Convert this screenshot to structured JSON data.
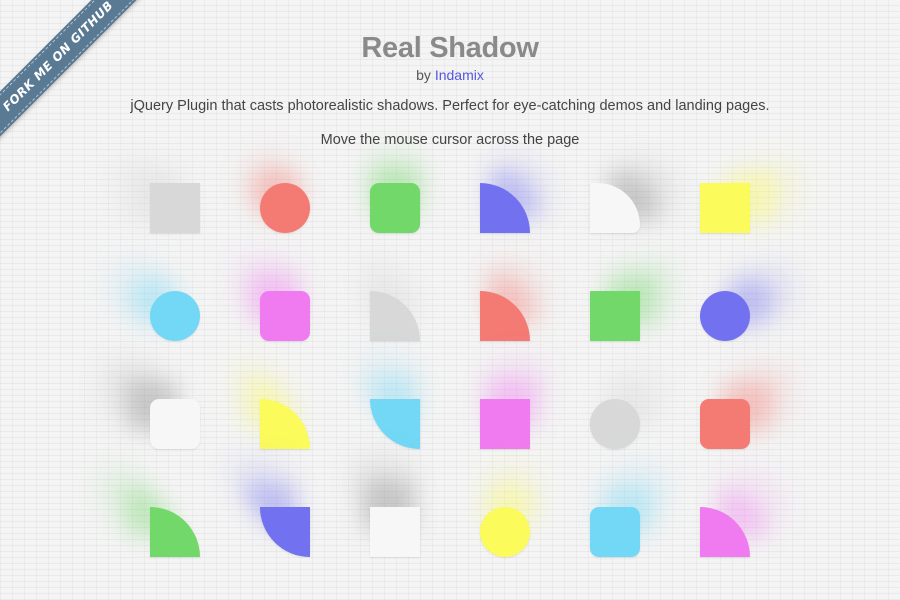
{
  "ribbon": {
    "label": "FORK ME ON GITHUB"
  },
  "header": {
    "title": "Real Shadow",
    "by_prefix": "by",
    "author": "Indamix",
    "description": "jQuery Plugin that casts photorealistic shadows. Perfect for eye-catching demos and landing pages.",
    "hint": "Move the mouse cursor across the page"
  },
  "colors": {
    "gray": "#d8d8d8",
    "red": "#f47a74",
    "green": "#72d86a",
    "blue": "#7272f0",
    "white": "#f7f7f7",
    "yellow": "#fbfb5c",
    "cyan": "#72d8f6",
    "pink": "#f07af0",
    "link": "#5555e0",
    "ribbon": "#5a7a94"
  },
  "shapes": [
    [
      {
        "kind": "square",
        "color": "gray"
      },
      {
        "kind": "circle",
        "color": "red"
      },
      {
        "kind": "rounded",
        "color": "green"
      },
      {
        "kind": "quarter",
        "color": "blue"
      },
      {
        "kind": "quarter-rounded",
        "color": "white"
      },
      {
        "kind": "square",
        "color": "yellow"
      }
    ],
    [
      {
        "kind": "circle",
        "color": "cyan"
      },
      {
        "kind": "rounded",
        "color": "pink"
      },
      {
        "kind": "quarter",
        "color": "gray"
      },
      {
        "kind": "quarter",
        "color": "red"
      },
      {
        "kind": "square",
        "color": "green"
      },
      {
        "kind": "circle",
        "color": "blue"
      }
    ],
    [
      {
        "kind": "rounded",
        "color": "white"
      },
      {
        "kind": "quarter",
        "color": "yellow"
      },
      {
        "kind": "quarter-flip",
        "color": "cyan"
      },
      {
        "kind": "square",
        "color": "pink"
      },
      {
        "kind": "circle",
        "color": "gray"
      },
      {
        "kind": "rounded",
        "color": "red"
      }
    ],
    [
      {
        "kind": "quarter",
        "color": "green"
      },
      {
        "kind": "quarter-flip",
        "color": "blue"
      },
      {
        "kind": "square",
        "color": "white"
      },
      {
        "kind": "circle",
        "color": "yellow"
      },
      {
        "kind": "rounded",
        "color": "cyan"
      },
      {
        "kind": "quarter",
        "color": "pink"
      }
    ]
  ]
}
